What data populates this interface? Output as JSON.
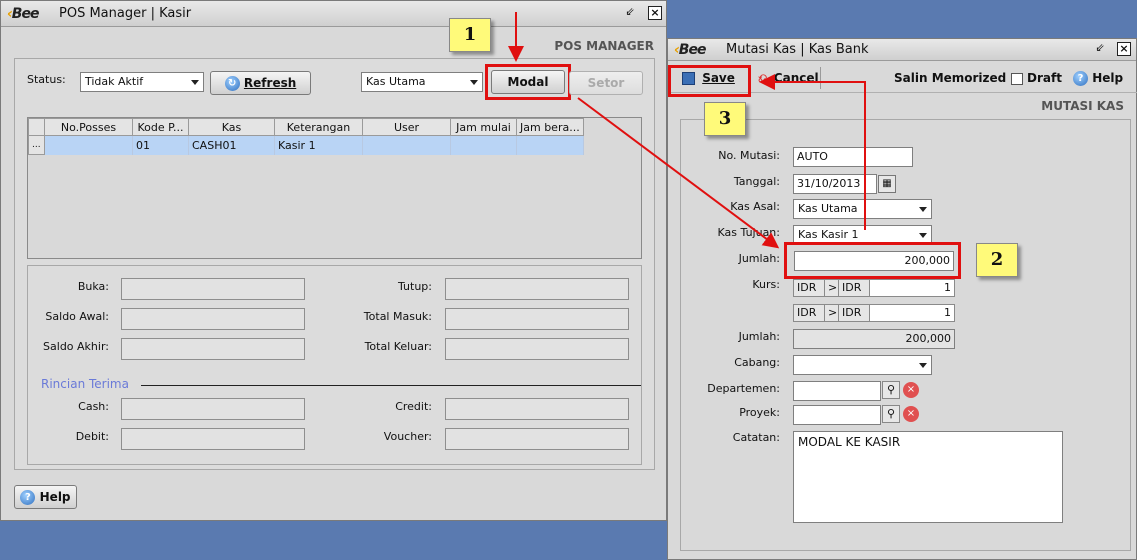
{
  "pos_window": {
    "title": "POS Manager | Kasir",
    "logo": "Bee",
    "section_title": "POS MANAGER",
    "status_label": "Status:",
    "status_value": "Tidak Aktif",
    "refresh_label": "Refresh",
    "kas_select_value": "Kas Utama",
    "modal_label": "Modal",
    "setor_label": "Setor",
    "table": {
      "columns": [
        "No.Posses",
        "Kode P...",
        "Kas",
        "Keterangan",
        "User",
        "Jam mulai",
        "Jam bera..."
      ],
      "rows": [
        {
          "marker": "...",
          "no_posses": "",
          "kode": "01",
          "kas": "CASH01",
          "keterangan": "Kasir 1",
          "user": "",
          "jam_mulai": "",
          "jam_berakhir": ""
        }
      ]
    },
    "fields": {
      "buka": "Buka:",
      "tutup": "Tutup:",
      "saldo_awal": "Saldo Awal:",
      "total_masuk": "Total Masuk:",
      "saldo_akhir": "Saldo Akhir:",
      "total_keluar": "Total Keluar:",
      "rincian_terima": "Rincian Terima",
      "cash": "Cash:",
      "credit": "Credit:",
      "debit": "Debit:",
      "voucher": "Voucher:"
    },
    "help_label": "Help"
  },
  "kas_window": {
    "title": "Mutasi Kas | Kas Bank",
    "logo": "Bee",
    "toolbar": {
      "save": "Save",
      "cancel": "Cancel",
      "salin": "Salin Memorized",
      "draft": "Draft",
      "help": "Help"
    },
    "section_title": "MUTASI KAS",
    "form": {
      "no_mutasi_label": "No. Mutasi:",
      "no_mutasi_value": "AUTO",
      "tanggal_label": "Tanggal:",
      "tanggal_value": "31/10/2013",
      "kas_asal_label": "Kas Asal:",
      "kas_asal_value": "Kas Utama",
      "kas_tujuan_label": "Kas Tujuan:",
      "kas_tujuan_value": "Kas Kasir 1",
      "jumlah_label": "Jumlah:",
      "jumlah_value": "200,000",
      "kurs_label": "Kurs:",
      "kurs_rows": [
        {
          "from": "IDR",
          "op": ">",
          "to": "IDR",
          "rate": "1"
        },
        {
          "from": "IDR",
          "op": ">",
          "to": "IDR",
          "rate": "1"
        }
      ],
      "jumlah2_label": "Jumlah:",
      "jumlah2_value": "200,000",
      "cabang_label": "Cabang:",
      "cabang_value": "",
      "departemen_label": "Departemen:",
      "departemen_value": "",
      "proyek_label": "Proyek:",
      "proyek_value": "",
      "catatan_label": "Catatan:",
      "catatan_value": "MODAL KE KASIR"
    }
  },
  "callouts": {
    "one": "1",
    "two": "2",
    "three": "3"
  },
  "colors": {
    "desktop": "#5a7ab0",
    "annotation_red": "#e01010",
    "callout_yellow": "#fffa7a",
    "row_selected": "#b9d4f5"
  }
}
